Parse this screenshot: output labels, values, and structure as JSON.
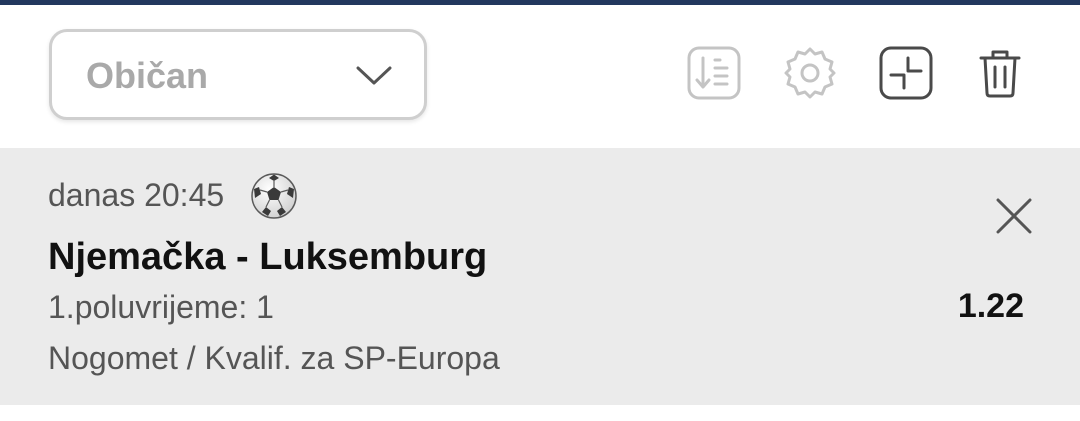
{
  "toolbar": {
    "bet_type": {
      "selected": "Običan"
    },
    "icons": [
      "sort-icon",
      "settings-icon",
      "collapse-icon",
      "trash-icon"
    ]
  },
  "event": {
    "time": "danas 20:45",
    "sport_icon": "soccer-ball-icon",
    "teams": "Njemačka - Luksemburg",
    "market": "1.poluvrijeme: 1",
    "odd": "1.22",
    "league": "Nogomet / Kvalif. za SP-Europa"
  },
  "colors": {
    "top_accent": "#22385e",
    "card_background": "#ebebeb",
    "muted_text": "#555555",
    "primary_text": "#111111",
    "disabled_icon": "#c4c4c4",
    "active_icon": "#4a4a4a"
  }
}
